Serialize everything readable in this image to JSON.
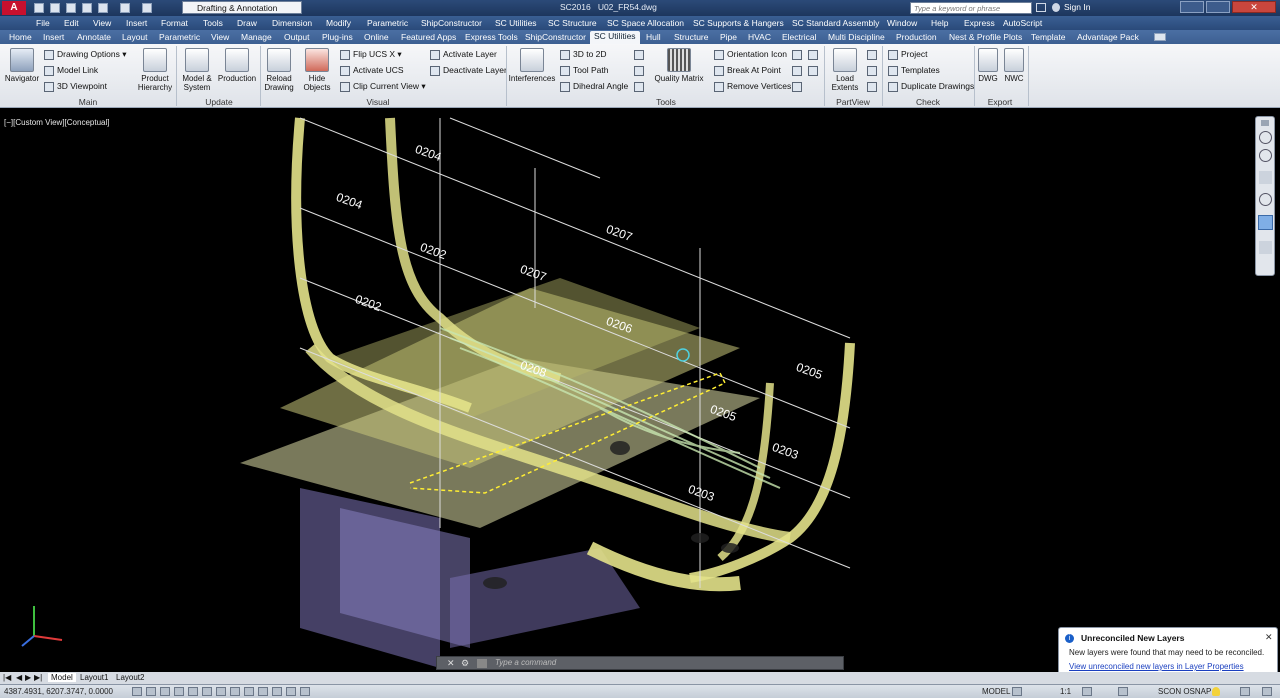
{
  "title_bar": {
    "workspace": "Drafting & Annotation",
    "app_title": "SC2016",
    "file_name": "U02_FR54.dwg",
    "search_placeholder": "Type a keyword or phrase",
    "sign_in": "Sign In"
  },
  "menu_bar": [
    "File",
    "Edit",
    "View",
    "Insert",
    "Format",
    "Tools",
    "Draw",
    "Dimension",
    "Modify",
    "Parametric",
    "ShipConstructor",
    "SC Utilities",
    "SC Structure",
    "SC Space Allocation",
    "SC Supports & Hangers",
    "SC Standard Assembly",
    "Window",
    "Help",
    "Express",
    "AutoScript"
  ],
  "ribbon_tabs": [
    "Home",
    "Insert",
    "Annotate",
    "Layout",
    "Parametric",
    "View",
    "Manage",
    "Output",
    "Plug-ins",
    "Online",
    "Featured Apps",
    "Express Tools",
    "ShipConstructor",
    "SC Utilities",
    "Hull",
    "Structure",
    "Pipe",
    "HVAC",
    "Electrical",
    "Multi Discipline",
    "Production",
    "Nest & Profile Plots",
    "Template",
    "Advantage Pack"
  ],
  "active_ribbon_tab": "SC Utilities",
  "ribbon": {
    "main": {
      "label": "Main",
      "navigator": "Navigator",
      "drawing_options": "Drawing Options",
      "model_link": "Model Link",
      "viewpoint": "3D Viewpoint",
      "product_hierarchy_1": "Product",
      "product_hierarchy_2": "Hierarchy"
    },
    "update": {
      "label": "Update",
      "model_system_1": "Model &",
      "model_system_2": "System",
      "production": "Production"
    },
    "visual": {
      "label": "Visual",
      "reload_1": "Reload",
      "reload_2": "Drawing",
      "hide_1": "Hide",
      "hide_2": "Objects",
      "flip_ucs": "Flip UCS X",
      "activate_ucs": "Activate UCS",
      "clip_view": "Clip Current View",
      "activate_layer": "Activate Layer",
      "deactivate_layer": "Deactivate Layer"
    },
    "tools": {
      "label": "Tools",
      "interferences": "Interferences",
      "to2d": "3D to 2D",
      "tool_path": "Tool Path",
      "dihedral": "Dihedral Angle",
      "quality_matrix": "Quality Matrix",
      "orientation_icon": "Orientation Icon",
      "break_at_point": "Break At Point",
      "remove_vertices": "Remove Vertices"
    },
    "partview": {
      "label": "PartView",
      "load_1": "Load",
      "load_2": "Extents"
    },
    "check": {
      "label": "Check",
      "project": "Project",
      "templates": "Templates",
      "duplicate": "Duplicate Drawings"
    },
    "export": {
      "label": "Export",
      "dwg": "DWG",
      "nwc": "NWC"
    }
  },
  "viewport": {
    "view_label": "[−][Custom View][Conceptual]",
    "frame_labels": [
      "0204",
      "0204",
      "0202",
      "0202",
      "0207",
      "0207",
      "0206",
      "0208",
      "0205",
      "0205",
      "0203",
      "0203"
    ]
  },
  "command_line": {
    "placeholder": "Type a command"
  },
  "layout_tabs": [
    "Model",
    "Layout1",
    "Layout2"
  ],
  "status": {
    "coordinates": "4387.4931, 6207.3747, 0.0000",
    "model": "MODEL",
    "scale": "1:1",
    "scon": "SCON OSNAP"
  },
  "notification": {
    "title": "Unreconciled New Layers",
    "body": "New layers were found that may need to be reconciled.",
    "link": "View unreconciled new layers in Layer Properties Manager"
  },
  "colors": {
    "titlebar": "#1d365d",
    "accent": "#2a4a7a",
    "hull": "#e3e28a",
    "plate": "#c9c77a",
    "purple": "#8e86c9",
    "link": "#1a3fbf"
  }
}
